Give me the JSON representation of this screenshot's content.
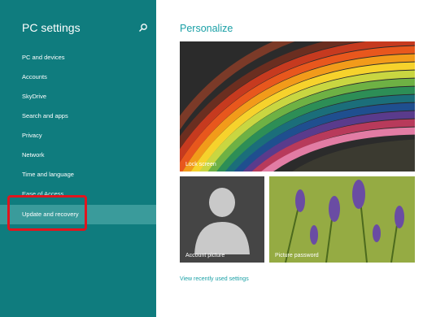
{
  "sidebar": {
    "title": "PC settings",
    "search_icon": "search-icon",
    "items": [
      {
        "label": "PC and devices"
      },
      {
        "label": "Accounts"
      },
      {
        "label": "SkyDrive"
      },
      {
        "label": "Search and apps"
      },
      {
        "label": "Privacy"
      },
      {
        "label": "Network"
      },
      {
        "label": "Time and language"
      },
      {
        "label": "Ease of Access"
      },
      {
        "label": "Update and recovery"
      }
    ],
    "selected_item": "Update and recovery"
  },
  "main": {
    "title": "Personalize",
    "tiles": {
      "lock_screen": "Lock screen",
      "account_picture": "Account picture",
      "picture_password": "Picture password"
    },
    "recent_link": "View recently used settings"
  },
  "colors": {
    "sidebar_bg": "#0f7c7e",
    "selected_item_bg": "#3a9b9b",
    "accent": "#1aa0a6",
    "highlight": "#e0151e"
  }
}
